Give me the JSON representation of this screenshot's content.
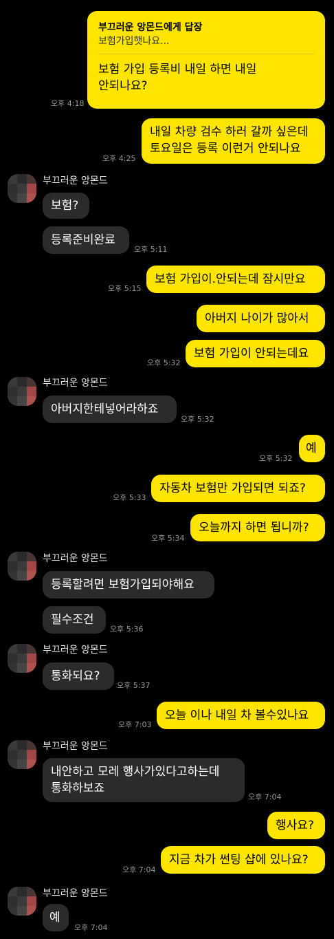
{
  "messages": [
    {
      "id": "m1",
      "reply_header": "부끄러운 앙몬드에게 답장",
      "reply_quote": "보험가입햇나요...",
      "lines": [
        "보험 가입 등록비 내일 하면 내일",
        "안되나요?"
      ],
      "time": "오후 4:18"
    },
    {
      "id": "m2",
      "lines": [
        "내일 차량 검수 하러 갈까 싶은데",
        "토요일은 등록 이런거 안되나요"
      ],
      "time": "오후 4:25"
    },
    {
      "id": "g1",
      "sender": "부끄러운 앙몬드"
    },
    {
      "id": "m3",
      "lines": [
        "보험?"
      ]
    },
    {
      "id": "m4",
      "lines": [
        "등록준비완료"
      ],
      "time": "오후 5:11"
    },
    {
      "id": "m5",
      "lines": [
        "보험 가입이.안되는데 잠시만요"
      ],
      "time": "오후 5:15"
    },
    {
      "id": "m6",
      "lines": [
        "아버지 나이가 많아서"
      ]
    },
    {
      "id": "m7",
      "lines": [
        "보험 가입이 안되는데요"
      ],
      "time": "오후 5:32"
    },
    {
      "id": "g2",
      "sender": "부끄러운 앙몬드"
    },
    {
      "id": "m8",
      "lines": [
        "아버지한테넣어라하죠"
      ],
      "time": "오후 5:32"
    },
    {
      "id": "m9",
      "lines": [
        "예"
      ],
      "time": "오후 5:32"
    },
    {
      "id": "m10",
      "lines": [
        "자동차 보험만 가입되면 되죠?"
      ],
      "time": "오후 5:33"
    },
    {
      "id": "m11",
      "lines": [
        "오늘까지 하면 됩니까?"
      ],
      "time": "오후 5:34"
    },
    {
      "id": "g3",
      "sender": "부끄러운 앙몬드"
    },
    {
      "id": "m12",
      "lines": [
        "등록할려면 보험가입되야해요"
      ]
    },
    {
      "id": "m13",
      "lines": [
        "필수조건"
      ],
      "time": "오후 5:36"
    },
    {
      "id": "g4",
      "sender": "부끄러운 앙몬드"
    },
    {
      "id": "m14",
      "lines": [
        "통화되요?"
      ],
      "time": "오후 5:37"
    },
    {
      "id": "m15",
      "lines": [
        "오늘 이나 내일 차 볼수있나요"
      ],
      "time": "오후 7:03"
    },
    {
      "id": "g5",
      "sender": "부끄러운 앙몬드"
    },
    {
      "id": "m16",
      "lines": [
        "내안하고 모레 행사가있다고하는데",
        "통화하보죠"
      ],
      "time": "오후 7:04"
    },
    {
      "id": "m17",
      "lines": [
        "행사요?"
      ]
    },
    {
      "id": "m18",
      "lines": [
        "지금 차가 썬팅 샵에 있나요?"
      ],
      "time": "오후 7:04"
    },
    {
      "id": "g6",
      "sender": "부끄러운 앙몬드"
    },
    {
      "id": "m19",
      "lines": [
        "예"
      ],
      "time": "오후 7:04"
    }
  ],
  "colors": {
    "my_bubble": "#FEE500",
    "their_bubble": "#2b2b2b",
    "background": "#000000"
  }
}
